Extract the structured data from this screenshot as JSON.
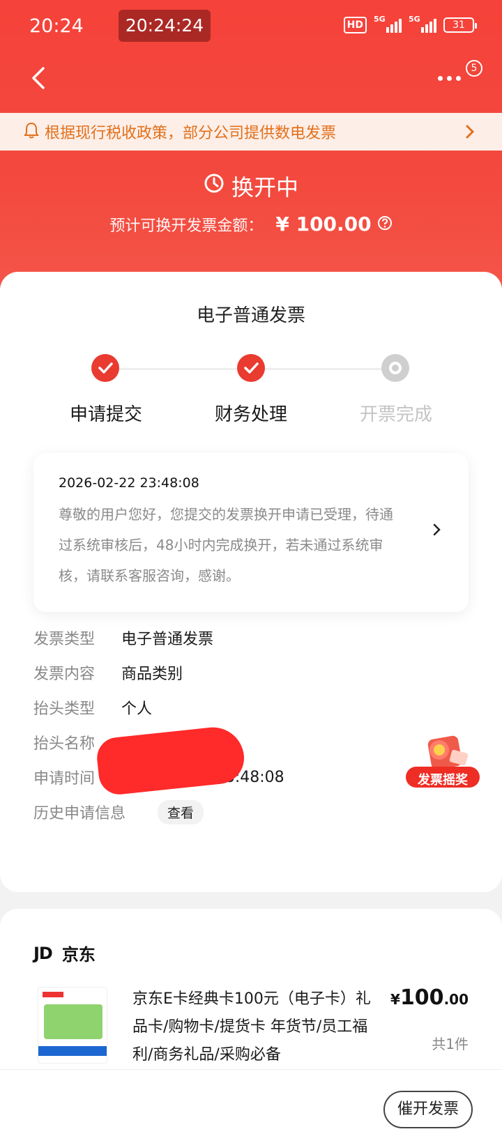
{
  "status_bar": {
    "time": "20:24",
    "clock_pill": "20:24:24",
    "hd_label": "HD",
    "signal1": "5G",
    "signal2": "5G",
    "battery": "31"
  },
  "nav": {
    "back_icon": "back-chevron-icon",
    "more_icon": "more-dots-icon",
    "more_badge": "5"
  },
  "notice": {
    "icon": "bell-icon",
    "text": "根据现行税收政策，部分公司提供数电发票"
  },
  "status_header": {
    "icon": "clock-icon",
    "title": "换开中",
    "amount_label": "预计可换开发票金额：",
    "amount": "¥ 100.00"
  },
  "invoice": {
    "title": "电子普通发票",
    "steps": [
      {
        "label": "申请提交",
        "state": "done"
      },
      {
        "label": "财务处理",
        "state": "done"
      },
      {
        "label": "开票完成",
        "state": "pending"
      }
    ],
    "message": {
      "timestamp": "2026-02-22 23:48:08",
      "body": "尊敬的用户您好，您提交的发票换开申请已受理，待通过系统审核后，48小时内完成换开，若未通过系统审核，请联系客服咨询，感谢。"
    },
    "details": [
      {
        "key": "发票类型",
        "value": "电子普通发票"
      },
      {
        "key": "发票内容",
        "value": "商品类别"
      },
      {
        "key": "抬头类型",
        "value": "个人"
      },
      {
        "key": "抬头名称",
        "value": ""
      },
      {
        "key": "申请时间",
        "value": "2026-02-22 23:48:08"
      },
      {
        "key": "历史申请信息",
        "value": ""
      }
    ],
    "view_button": "查看",
    "lottery_label": "发票摇奖"
  },
  "product": {
    "shop_logo": "JD",
    "shop_name": "京东",
    "name": "京东E卡经典卡100元（电子卡）礼品卡/购物卡/提货卡 年货节/员工福利/商务礼品/采购必备",
    "price_currency": "¥",
    "price_int": "100",
    "price_dec": ".00",
    "quantity": "共1件"
  },
  "bottom": {
    "urge_button": "催开发票"
  },
  "colors": {
    "accent": "#e93b30",
    "notice_text": "#e1701b"
  }
}
